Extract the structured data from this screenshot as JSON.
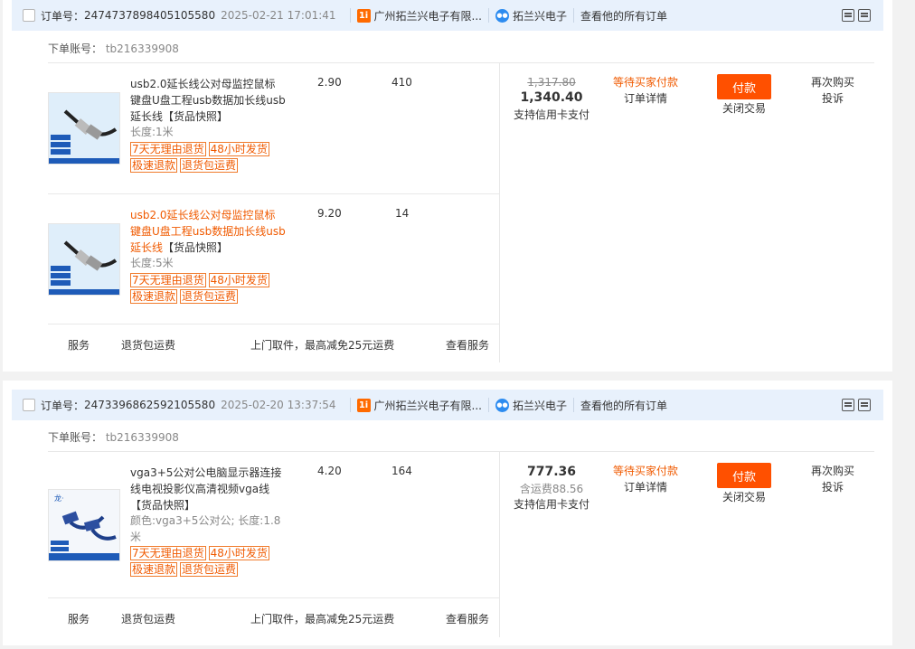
{
  "common": {
    "order_no_label": "订单号：",
    "shop_badge": "1i",
    "shop": "广州拓兰兴电子有限...",
    "seller": "拓兰兴电子",
    "see_all": "查看他的所有订单",
    "account_label": "下单账号：",
    "account": "tb216339908",
    "service_label": "服务",
    "service_return": "退货包运费",
    "service_desc": "上门取件，最高减免25元运费",
    "service_view": "查看服务",
    "pay_button": "付款",
    "close_deal": "关闭交易",
    "rebuy": "再次购买",
    "complain": "投诉",
    "status": "等待买家付款",
    "order_detail": "订单详情",
    "credit": "支持信用卡支付",
    "snapshot": "【货品快照】",
    "tags": [
      "7天无理由退货",
      "48小时发货",
      "极速退款",
      "退货包运费"
    ],
    "colors": {
      "orange": "#f05a00",
      "pay": "#ff5000",
      "header_bg": "#e8f1fc"
    }
  },
  "orders": [
    {
      "order_no": "2474737898405105580",
      "time": "2025-02-21 17:01:41",
      "original_price": "1,317.80",
      "total": "1,340.40",
      "items": [
        {
          "title": "usb2.0延长线公对母监控鼠标键盘U盘工程usb数据加长线usb延长线",
          "spec": "长度:1米",
          "unit_price": "2.90",
          "qty": "410",
          "image": "usb-cable-image"
        },
        {
          "title": "usb2.0延长线公对母监控鼠标键盘U盘工程usb数据加长线usb延长线",
          "spec": "长度:5米",
          "unit_price": "9.20",
          "qty": "14",
          "image": "usb-cable-image"
        }
      ]
    },
    {
      "order_no": "2473396862592105580",
      "time": "2025-02-20 13:37:54",
      "total": "777.36",
      "shipping": "含运费88.56",
      "items": [
        {
          "title": "vga3+5公对公电脑显示器连接线电视投影仪高清视频vga线",
          "spec": "颜色:vga3+5公对公; 长度:1.8米",
          "unit_price": "4.20",
          "qty": "164",
          "image": "vga-cable-image"
        }
      ]
    }
  ]
}
